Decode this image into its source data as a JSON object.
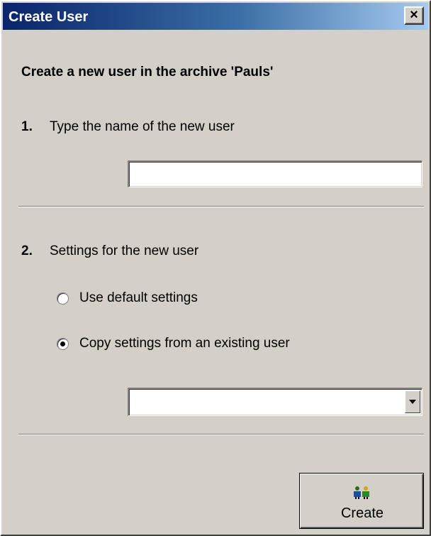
{
  "window": {
    "title": "Create User",
    "close_glyph": "×"
  },
  "heading": "Create a new user in the archive 'Pauls'",
  "step1": {
    "number": "1.",
    "label": "Type the name of the new user",
    "name_value": ""
  },
  "step2": {
    "number": "2.",
    "label": "Settings for the new user",
    "options": [
      {
        "label": "Use default settings",
        "selected": false
      },
      {
        "label": "Copy settings from an existing user",
        "selected": true
      }
    ],
    "existing_user_value": ""
  },
  "create_button": {
    "label": "Create",
    "icon": "users-icon"
  }
}
